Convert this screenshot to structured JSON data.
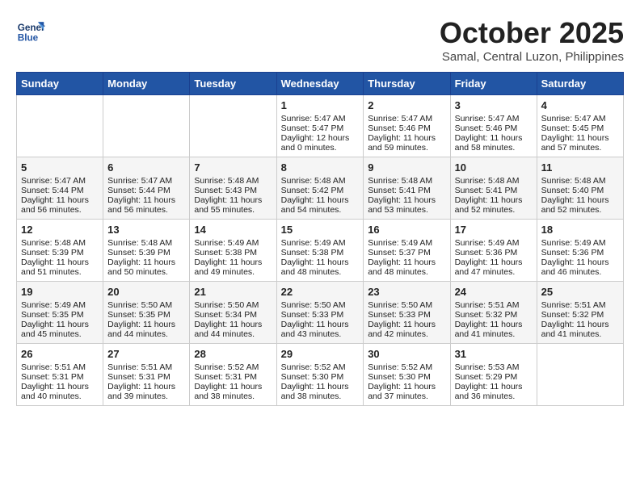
{
  "header": {
    "logo_line1": "General",
    "logo_line2": "Blue",
    "month": "October 2025",
    "location": "Samal, Central Luzon, Philippines"
  },
  "weekdays": [
    "Sunday",
    "Monday",
    "Tuesday",
    "Wednesday",
    "Thursday",
    "Friday",
    "Saturday"
  ],
  "weeks": [
    [
      {
        "day": "",
        "sunrise": "",
        "sunset": "",
        "daylight": "",
        "empty": true
      },
      {
        "day": "",
        "sunrise": "",
        "sunset": "",
        "daylight": "",
        "empty": true
      },
      {
        "day": "",
        "sunrise": "",
        "sunset": "",
        "daylight": "",
        "empty": true
      },
      {
        "day": "1",
        "sunrise": "Sunrise: 5:47 AM",
        "sunset": "Sunset: 5:47 PM",
        "daylight": "Daylight: 12 hours and 0 minutes."
      },
      {
        "day": "2",
        "sunrise": "Sunrise: 5:47 AM",
        "sunset": "Sunset: 5:46 PM",
        "daylight": "Daylight: 11 hours and 59 minutes."
      },
      {
        "day": "3",
        "sunrise": "Sunrise: 5:47 AM",
        "sunset": "Sunset: 5:46 PM",
        "daylight": "Daylight: 11 hours and 58 minutes."
      },
      {
        "day": "4",
        "sunrise": "Sunrise: 5:47 AM",
        "sunset": "Sunset: 5:45 PM",
        "daylight": "Daylight: 11 hours and 57 minutes."
      }
    ],
    [
      {
        "day": "5",
        "sunrise": "Sunrise: 5:47 AM",
        "sunset": "Sunset: 5:44 PM",
        "daylight": "Daylight: 11 hours and 56 minutes."
      },
      {
        "day": "6",
        "sunrise": "Sunrise: 5:47 AM",
        "sunset": "Sunset: 5:44 PM",
        "daylight": "Daylight: 11 hours and 56 minutes."
      },
      {
        "day": "7",
        "sunrise": "Sunrise: 5:48 AM",
        "sunset": "Sunset: 5:43 PM",
        "daylight": "Daylight: 11 hours and 55 minutes."
      },
      {
        "day": "8",
        "sunrise": "Sunrise: 5:48 AM",
        "sunset": "Sunset: 5:42 PM",
        "daylight": "Daylight: 11 hours and 54 minutes."
      },
      {
        "day": "9",
        "sunrise": "Sunrise: 5:48 AM",
        "sunset": "Sunset: 5:41 PM",
        "daylight": "Daylight: 11 hours and 53 minutes."
      },
      {
        "day": "10",
        "sunrise": "Sunrise: 5:48 AM",
        "sunset": "Sunset: 5:41 PM",
        "daylight": "Daylight: 11 hours and 52 minutes."
      },
      {
        "day": "11",
        "sunrise": "Sunrise: 5:48 AM",
        "sunset": "Sunset: 5:40 PM",
        "daylight": "Daylight: 11 hours and 52 minutes."
      }
    ],
    [
      {
        "day": "12",
        "sunrise": "Sunrise: 5:48 AM",
        "sunset": "Sunset: 5:39 PM",
        "daylight": "Daylight: 11 hours and 51 minutes."
      },
      {
        "day": "13",
        "sunrise": "Sunrise: 5:48 AM",
        "sunset": "Sunset: 5:39 PM",
        "daylight": "Daylight: 11 hours and 50 minutes."
      },
      {
        "day": "14",
        "sunrise": "Sunrise: 5:49 AM",
        "sunset": "Sunset: 5:38 PM",
        "daylight": "Daylight: 11 hours and 49 minutes."
      },
      {
        "day": "15",
        "sunrise": "Sunrise: 5:49 AM",
        "sunset": "Sunset: 5:38 PM",
        "daylight": "Daylight: 11 hours and 48 minutes."
      },
      {
        "day": "16",
        "sunrise": "Sunrise: 5:49 AM",
        "sunset": "Sunset: 5:37 PM",
        "daylight": "Daylight: 11 hours and 48 minutes."
      },
      {
        "day": "17",
        "sunrise": "Sunrise: 5:49 AM",
        "sunset": "Sunset: 5:36 PM",
        "daylight": "Daylight: 11 hours and 47 minutes."
      },
      {
        "day": "18",
        "sunrise": "Sunrise: 5:49 AM",
        "sunset": "Sunset: 5:36 PM",
        "daylight": "Daylight: 11 hours and 46 minutes."
      }
    ],
    [
      {
        "day": "19",
        "sunrise": "Sunrise: 5:49 AM",
        "sunset": "Sunset: 5:35 PM",
        "daylight": "Daylight: 11 hours and 45 minutes."
      },
      {
        "day": "20",
        "sunrise": "Sunrise: 5:50 AM",
        "sunset": "Sunset: 5:35 PM",
        "daylight": "Daylight: 11 hours and 44 minutes."
      },
      {
        "day": "21",
        "sunrise": "Sunrise: 5:50 AM",
        "sunset": "Sunset: 5:34 PM",
        "daylight": "Daylight: 11 hours and 44 minutes."
      },
      {
        "day": "22",
        "sunrise": "Sunrise: 5:50 AM",
        "sunset": "Sunset: 5:33 PM",
        "daylight": "Daylight: 11 hours and 43 minutes."
      },
      {
        "day": "23",
        "sunrise": "Sunrise: 5:50 AM",
        "sunset": "Sunset: 5:33 PM",
        "daylight": "Daylight: 11 hours and 42 minutes."
      },
      {
        "day": "24",
        "sunrise": "Sunrise: 5:51 AM",
        "sunset": "Sunset: 5:32 PM",
        "daylight": "Daylight: 11 hours and 41 minutes."
      },
      {
        "day": "25",
        "sunrise": "Sunrise: 5:51 AM",
        "sunset": "Sunset: 5:32 PM",
        "daylight": "Daylight: 11 hours and 41 minutes."
      }
    ],
    [
      {
        "day": "26",
        "sunrise": "Sunrise: 5:51 AM",
        "sunset": "Sunset: 5:31 PM",
        "daylight": "Daylight: 11 hours and 40 minutes."
      },
      {
        "day": "27",
        "sunrise": "Sunrise: 5:51 AM",
        "sunset": "Sunset: 5:31 PM",
        "daylight": "Daylight: 11 hours and 39 minutes."
      },
      {
        "day": "28",
        "sunrise": "Sunrise: 5:52 AM",
        "sunset": "Sunset: 5:31 PM",
        "daylight": "Daylight: 11 hours and 38 minutes."
      },
      {
        "day": "29",
        "sunrise": "Sunrise: 5:52 AM",
        "sunset": "Sunset: 5:30 PM",
        "daylight": "Daylight: 11 hours and 38 minutes."
      },
      {
        "day": "30",
        "sunrise": "Sunrise: 5:52 AM",
        "sunset": "Sunset: 5:30 PM",
        "daylight": "Daylight: 11 hours and 37 minutes."
      },
      {
        "day": "31",
        "sunrise": "Sunrise: 5:53 AM",
        "sunset": "Sunset: 5:29 PM",
        "daylight": "Daylight: 11 hours and 36 minutes."
      },
      {
        "day": "",
        "sunrise": "",
        "sunset": "",
        "daylight": "",
        "empty": true
      }
    ]
  ]
}
